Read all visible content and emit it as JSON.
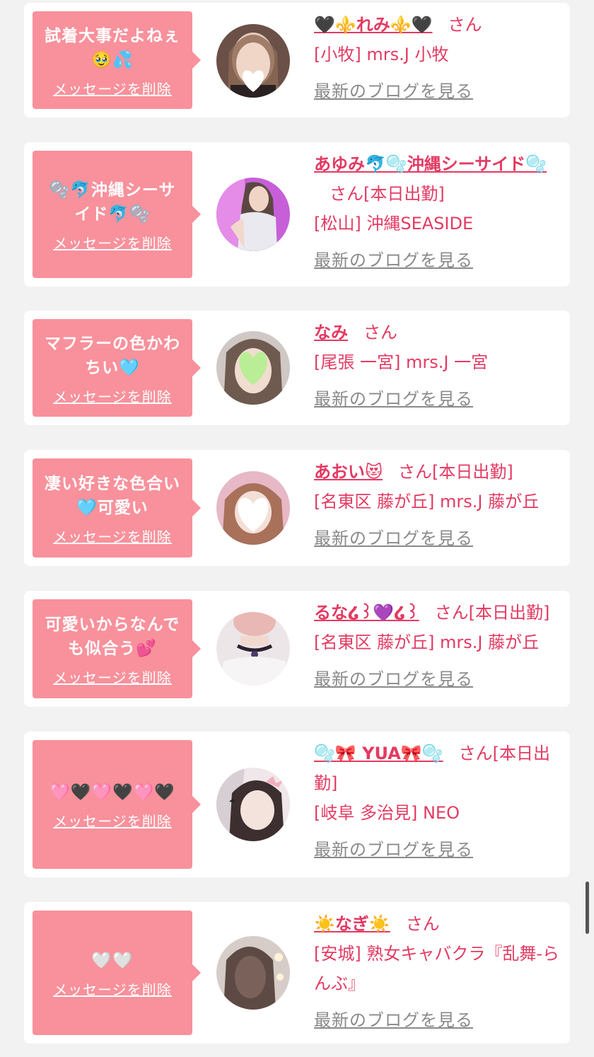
{
  "delete_label": "メッセージを削除",
  "blog_label": "最新のブログを見る",
  "san_label": "さん",
  "cards": [
    {
      "message": "試着大事だよねぇ🥹💦",
      "name": "🖤⚜️れみ⚜️🖤",
      "status": "",
      "shop": "[小牧] mrs.J 小牧"
    },
    {
      "message": "🫧🐬沖縄シーサイド🐬🫧",
      "name": "あゆみ🐬🫧沖縄シーサイド🫧",
      "status": "[本日出勤]",
      "shop": "[松山] 沖縄SEASIDE"
    },
    {
      "message": "マフラーの色かわちい🩵",
      "name": "なみ",
      "status": "",
      "shop": "[尾張 一宮] mrs.J 一宮"
    },
    {
      "message": "凄い好きな色合い🩵可愛い",
      "name": "あおい😻",
      "status": "[本日出勤]",
      "shop": "[名東区 藤が丘] mrs.J 藤が丘"
    },
    {
      "message": "可愛いからなんでも似合う💕",
      "name": "るな໒꒱💜໒꒱",
      "status": "[本日出勤]",
      "shop": "[名東区 藤が丘] mrs.J 藤が丘"
    },
    {
      "message": "🩷🖤🩷🖤🩷🖤",
      "name": "🫧🎀 YUA🎀🫧",
      "status": "[本日出勤]",
      "shop": "[岐阜 多治見] NEO"
    },
    {
      "message": "🤍🤍",
      "name": "☀️なぎ☀️",
      "status": "",
      "shop": "[安城] 熟女キャバクラ『乱舞-らんぶ』"
    }
  ],
  "colors": {
    "bubble": "#f8919b",
    "accent": "#e33a62",
    "link_gray": "#8a8a8a",
    "background": "#f2f2f2"
  }
}
